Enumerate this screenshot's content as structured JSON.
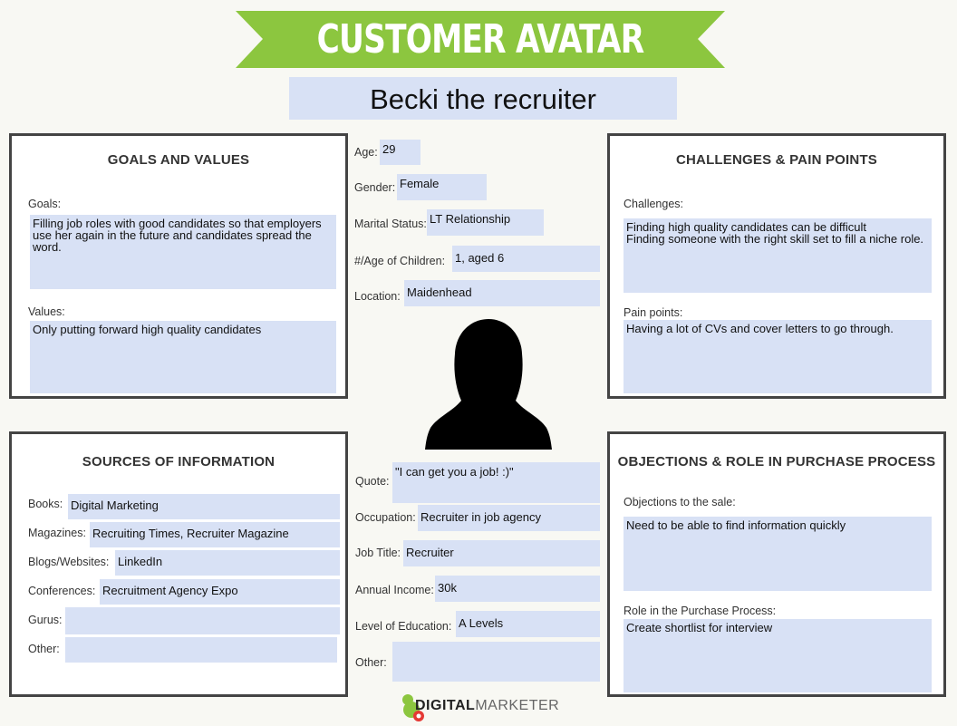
{
  "header": {
    "title": "CUSTOMER AVATAR",
    "avatar_name": "Becki the recruiter"
  },
  "colors": {
    "banner_green": "#8cc63f",
    "field_blue": "#d8e1f5",
    "panel_border": "#444444"
  },
  "goals_values": {
    "title": "GOALS AND VALUES",
    "goals_label": "Goals:",
    "goals": "Filling job roles with good candidates so that employers use her again in the future and candidates spread the word.",
    "values_label": "Values:",
    "values": "Only putting forward high quality candidates"
  },
  "challenges": {
    "title": "CHALLENGES & PAIN POINTS",
    "challenges_label": "Challenges:",
    "challenges_line1": "Finding high quality candidates can be difficult",
    "challenges_line2": "Finding someone with the right skill set to fill a niche role.",
    "pain_label": "Pain points:",
    "pain": "Having a lot of CVs and cover letters to go through."
  },
  "sources": {
    "title": "SOURCES OF INFORMATION",
    "books_label": "Books:",
    "books": "Digital Marketing",
    "magazines_label": "Magazines:",
    "magazines": "Recruiting Times, Recruiter Magazine",
    "blogs_label": "Blogs/Websites:",
    "blogs": "LinkedIn",
    "conferences_label": "Conferences:",
    "conferences": "Recruitment Agency Expo",
    "gurus_label": "Gurus:",
    "gurus": "",
    "other_label": "Other:",
    "other": ""
  },
  "objections": {
    "title": "OBJECTIONS & ROLE IN PURCHASE PROCESS",
    "objections_label": "Objections to the sale:",
    "objections": "Need to be able to find information quickly",
    "role_label": "Role in the Purchase Process:",
    "role": "Create shortlist for interview"
  },
  "demographics": {
    "age_label": "Age:",
    "age": "29",
    "gender_label": "Gender:",
    "gender": "Female",
    "marital_label": "Marital Status:",
    "marital": "LT Relationship",
    "children_label": "#/Age of Children:",
    "children": "1, aged 6",
    "location_label": "Location:",
    "location": "Maidenhead"
  },
  "profile": {
    "quote_label": "Quote:",
    "quote": "\"I can get you a job! :)\"",
    "occupation_label": "Occupation:",
    "occupation": "Recruiter in job agency",
    "job_title_label": "Job Title:",
    "job_title": "Recruiter",
    "income_label": "Annual Income:",
    "income": "30k",
    "education_label": "Level of Education:",
    "education": "A Levels",
    "other_label": "Other:",
    "other": ""
  },
  "footer": {
    "logo_bold": "DIGITAL",
    "logo_light": "MARKETER"
  }
}
